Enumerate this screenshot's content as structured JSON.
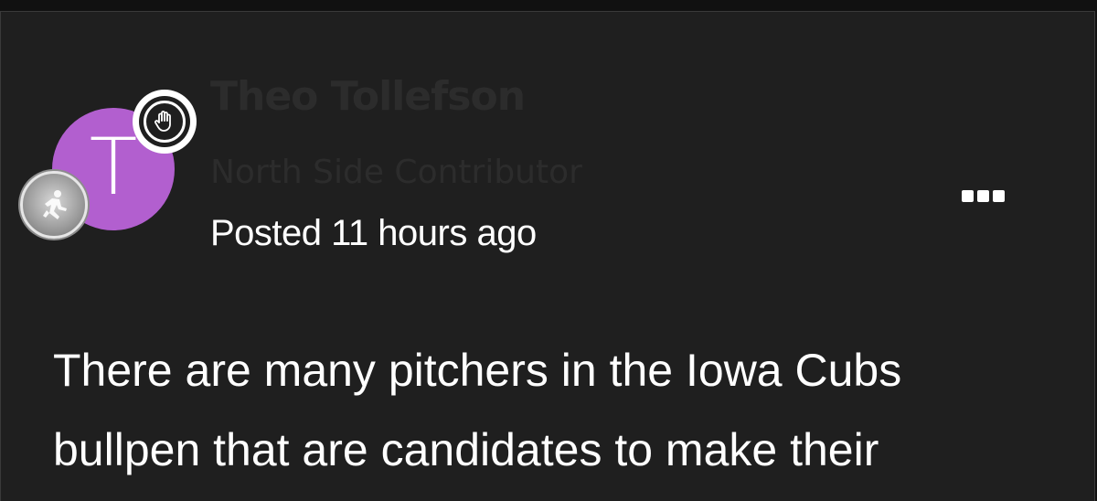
{
  "post": {
    "author": {
      "name": "Theo Tollefson",
      "title": "North Side Contributor",
      "avatar_letter": "T",
      "avatar_color": "#b25fcf"
    },
    "posted_text": "Posted 11 hours ago",
    "body_lines": [
      "There are many pitchers in the Iowa Cubs",
      "bullpen that are candidates to make their"
    ]
  },
  "icons": {
    "moderator_badge": "hand-icon",
    "rank_badge": "runner-medal-icon",
    "more_menu": "ellipsis-icon"
  }
}
